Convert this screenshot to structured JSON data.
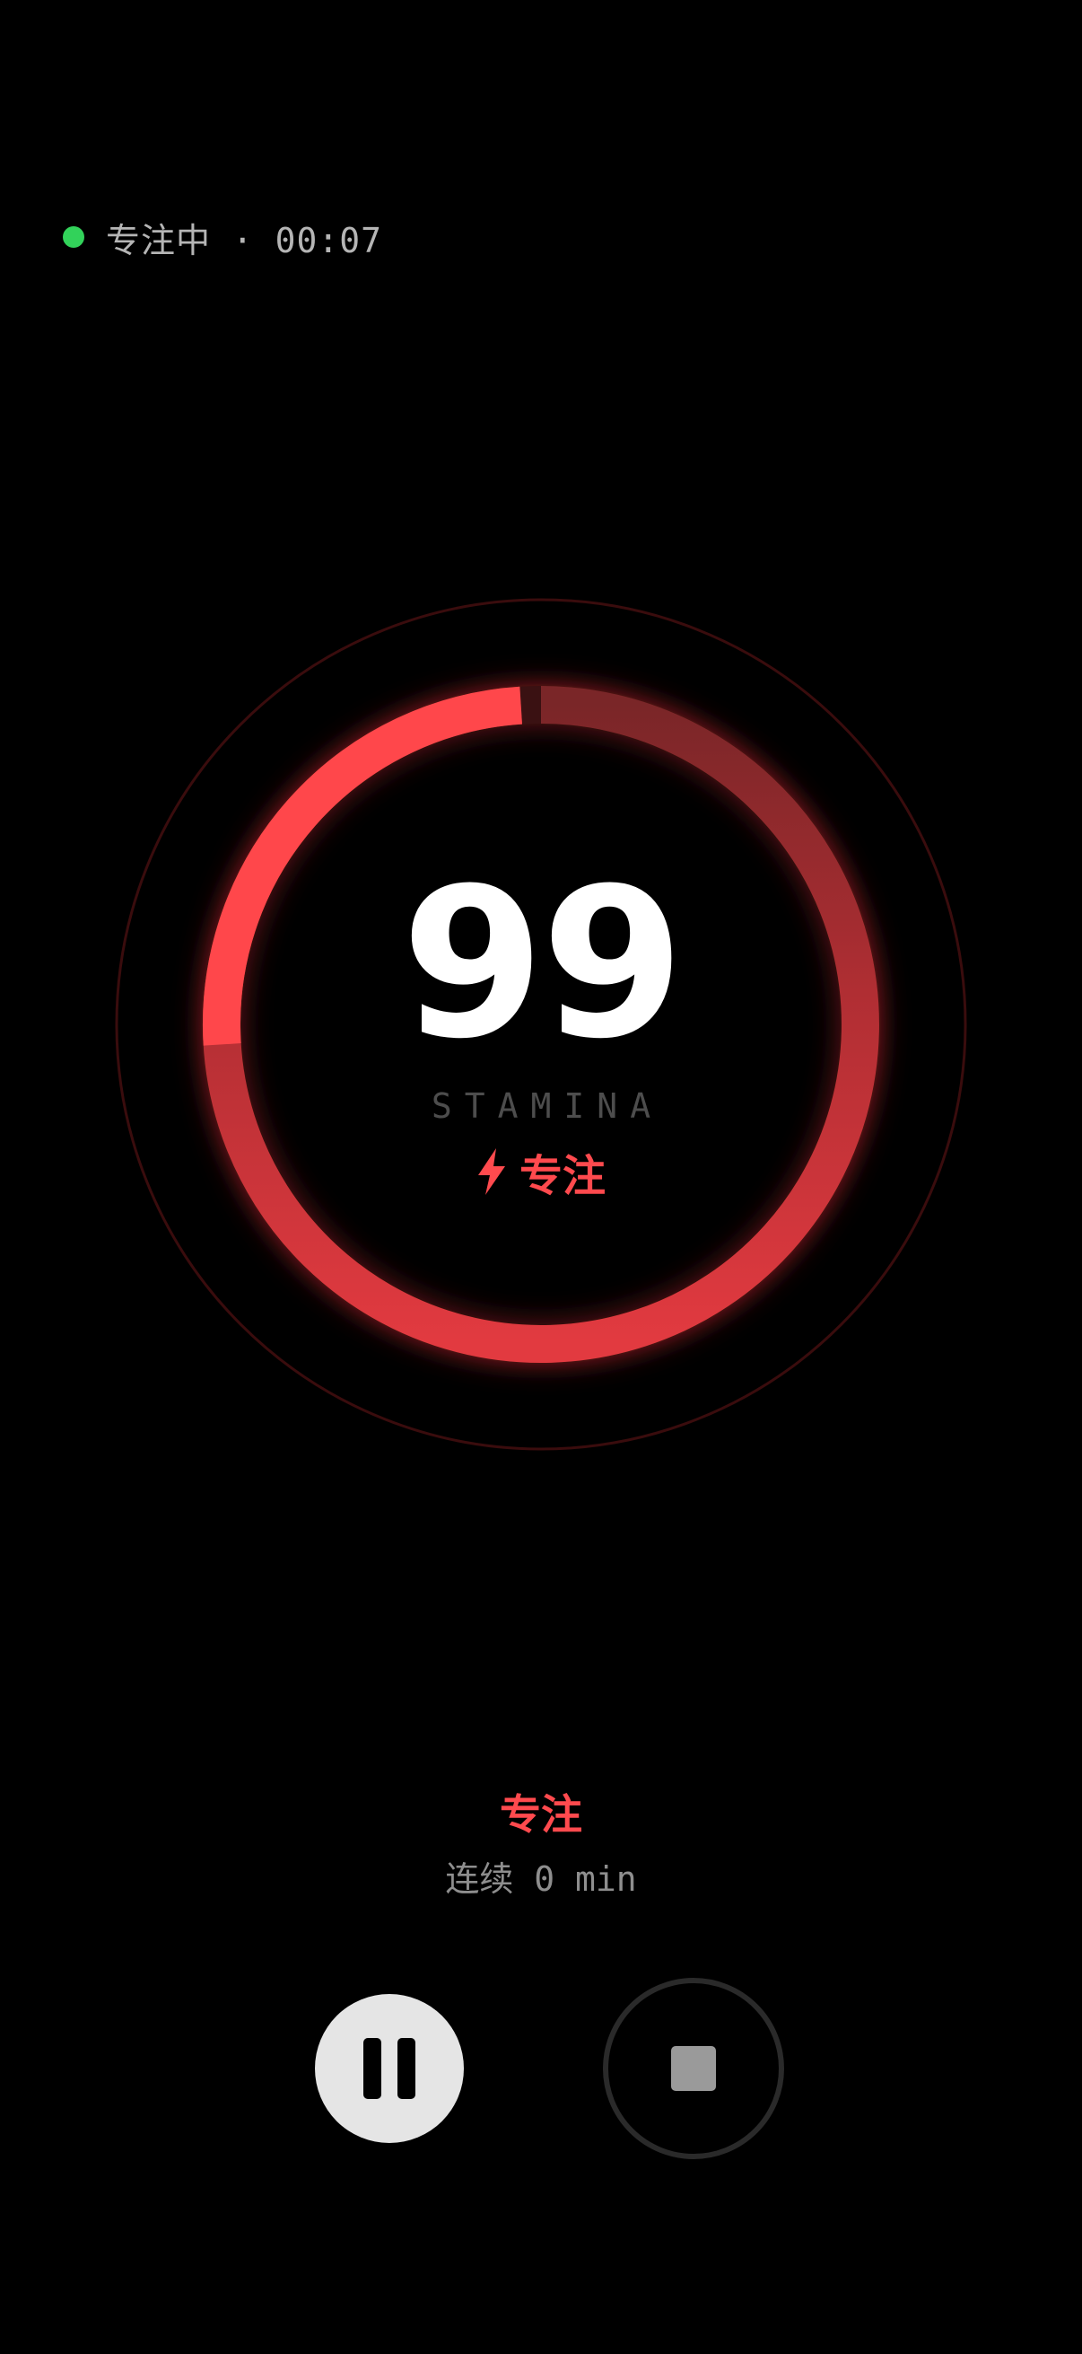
{
  "status": {
    "text": "专注中 · 00:07",
    "dot_color": "#32d25a"
  },
  "gauge": {
    "value": "99",
    "label": "STAMINA",
    "progress": 0.99,
    "accent_color": "#ff4a4e"
  },
  "mode": {
    "icon": "lightning-bolt-icon",
    "badge_label": "专注",
    "title": "专注",
    "streak": "连续 0 min"
  },
  "controls": {
    "pause_icon": "pause-icon",
    "stop_icon": "stop-icon"
  }
}
